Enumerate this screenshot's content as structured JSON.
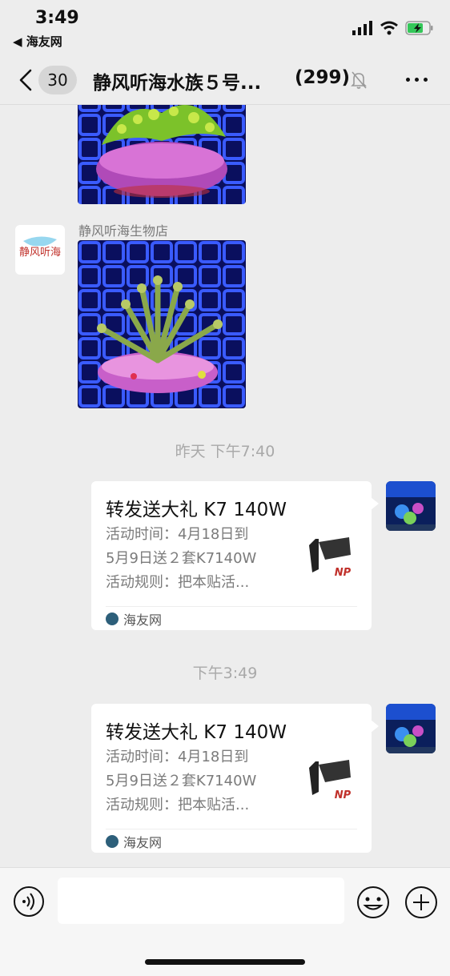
{
  "status_bar": {
    "time": "3:49",
    "back_app": "◀ 海友网"
  },
  "nav": {
    "unread_count": "30",
    "chat_title": "静风听海水族５号...",
    "member_count": "(299)"
  },
  "messages": {
    "sender_name": "静风听海生物店",
    "avatar_text": "静风听海",
    "timestamp_1": "昨天 下午7:40",
    "timestamp_2": "下午3:49",
    "card_1": {
      "title": "转发送大礼 K7 140W",
      "line1": "活动时间：4月18日到",
      "line2": "5月9日送２套K7140W",
      "line3": "活动规则：把本贴活...",
      "source": "海友网"
    },
    "card_2": {
      "title": "转发送大礼 K7 140W",
      "line1": "活动时间：4月18日到",
      "line2": "5月9日送２套K7140W",
      "line3": "活动规则：把本贴活...",
      "source": "海友网"
    }
  },
  "input": {
    "value": "",
    "placeholder": ""
  }
}
